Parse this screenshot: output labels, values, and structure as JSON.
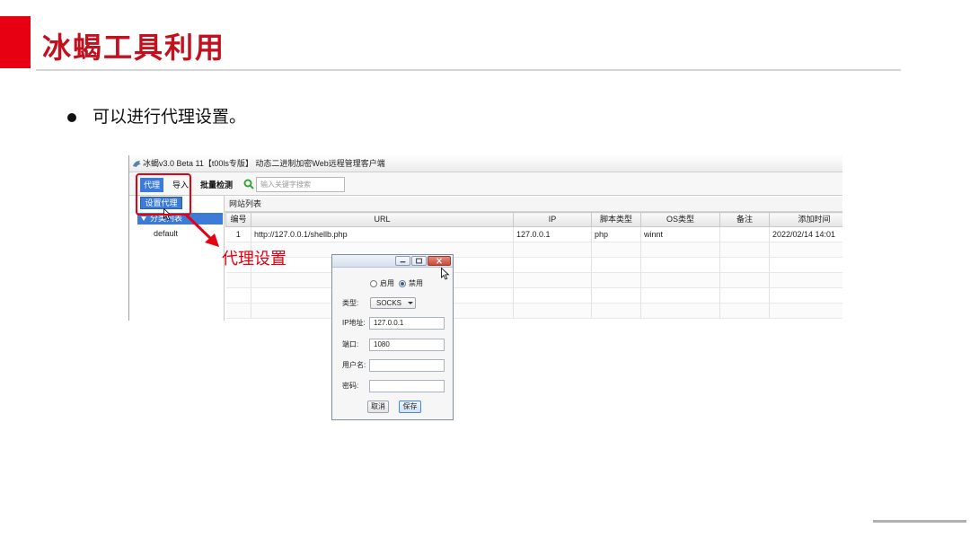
{
  "slide": {
    "title": "冰蝎工具利用",
    "bullets": [
      "可以进行代理设置。"
    ],
    "annotation_label": "代理设置"
  },
  "colors": {
    "accent_red": "#e60012",
    "title_red": "#c3101c",
    "selection_blue": "#3d7bd8",
    "search_icon_green": "#3aa33a"
  },
  "icons": {
    "app": "behinder-app-icon",
    "search": "search-icon",
    "tree_toggle": "chevron-down-icon",
    "cursor": "mouse-cursor-icon",
    "dialog_controls": [
      "minimize-icon",
      "maximize-icon",
      "close-icon"
    ],
    "select_arrow": "dropdown-arrow-icon",
    "annotation": "red-arrow-icon"
  },
  "app": {
    "window_title": "冰蝎v3.0 Beta 11【t00ls专版】 动态二进制加密Web远程管理客户端",
    "menu": {
      "proxy": "代理",
      "import": "导入",
      "batch_check": "批量检测"
    },
    "search_placeholder": "输入关键字搜索",
    "proxy_menu_item": "设置代理",
    "tree": {
      "root": "分类列表",
      "items": [
        "default"
      ]
    },
    "list_title": "网站列表",
    "table": {
      "columns": [
        "编号",
        "URL",
        "IP",
        "脚本类型",
        "OS类型",
        "备注",
        "添加时间"
      ],
      "rows": [
        {
          "cells": [
            "1",
            "http://127.0.0.1/shellb.php",
            "127.0.0.1",
            "php",
            "winnt",
            "",
            "2022/02/14 14:01"
          ]
        }
      ]
    }
  },
  "proxy_dialog": {
    "radio_enable_label": "启用",
    "radio_disable_label": "禁用",
    "proxy_enabled": false,
    "type_label": "类型:",
    "type_value": "SOCKS",
    "ip_label": "IP地址:",
    "ip_value": "127.0.0.1",
    "port_label": "端口:",
    "port_value": "1080",
    "username_label": "用户名:",
    "username_value": "",
    "password_label": "密码:",
    "password_value": "",
    "cancel_label": "取消",
    "save_label": "保存"
  }
}
